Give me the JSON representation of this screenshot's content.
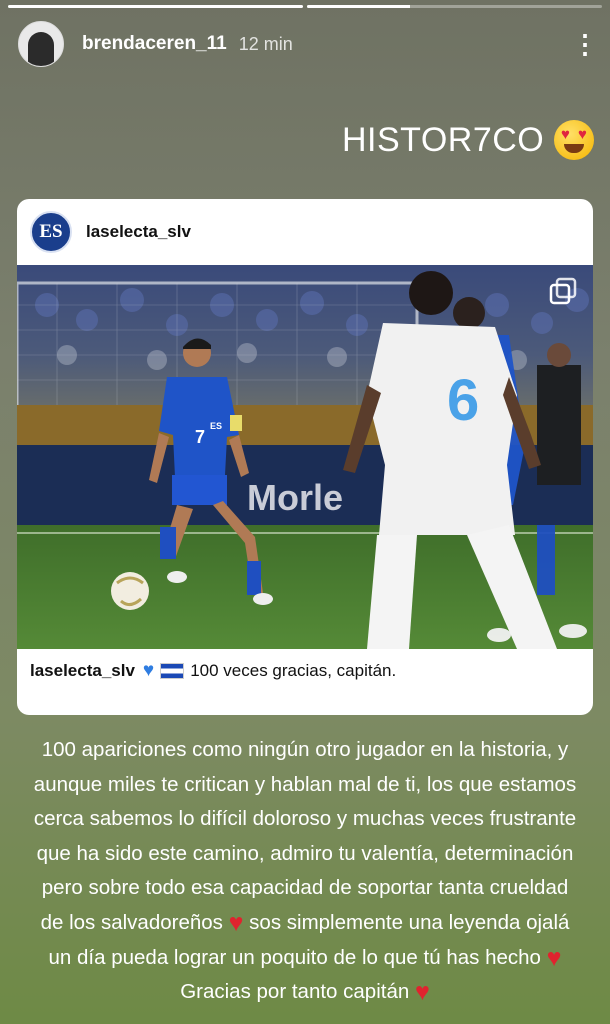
{
  "story": {
    "progress": [
      1.0,
      0.35
    ],
    "username": "brendaceren_11",
    "time": "12 min",
    "more_icon": "⋮",
    "caption": "HISTOR7CO",
    "caption_emoji": "heart-eyes-emoji"
  },
  "post": {
    "username": "laselecta_slv",
    "logo_text": "ES",
    "photo": {
      "description_icon": "multiple-photos-icon",
      "player_left_number": "7",
      "player_left_badge": "ES",
      "player_right_number": "6",
      "banner_text": "Morle"
    },
    "caption_user": "laselecta_slv",
    "caption_text": "100 veces gracias, capitán."
  },
  "body_lines": [
    "100 apariciones como ningún otro jugador en la historia, y",
    "aunque miles te critican y hablan mal de ti, los que estamos",
    "cerca sabemos lo difícil doloroso y muchas veces frustrante",
    "que ha sido este camino, admiro tu valentía, determinación",
    "pero sobre todo esa capacidad de soportar tanta crueldad",
    "de los salvadoreños",
    "sos simplemente una leyenda ojalá",
    "un día pueda lograr un poquito de lo que tú has hecho",
    "Gracias por tanto capitán"
  ],
  "colors": {
    "heart_red": "#e0232e",
    "heart_blue": "#2f7de1",
    "selecta_blue": "#1a3e8c"
  }
}
